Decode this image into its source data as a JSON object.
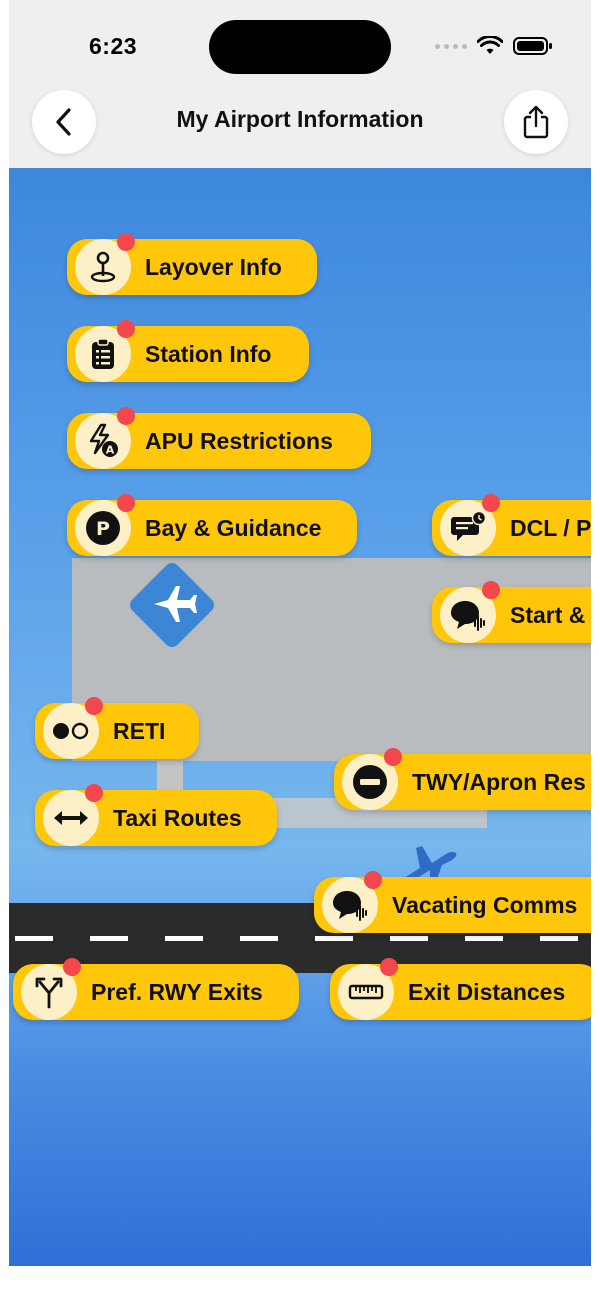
{
  "status_bar": {
    "time": "6:23"
  },
  "nav": {
    "title": "My Airport Information",
    "back_icon": "chevron-left-icon",
    "share_icon": "share-icon"
  },
  "colors": {
    "pill": "#ffc60a",
    "badge": "#f2474c",
    "map_top": "#3d87dc",
    "map_bottom": "#2f6fd6"
  },
  "items": [
    {
      "label": "Layover Info",
      "icon": "map-pin-icon",
      "badge": true
    },
    {
      "label": "Station Info",
      "icon": "clipboard-icon",
      "badge": true
    },
    {
      "label": "APU Restrictions",
      "icon": "lightning-a-icon",
      "badge": true
    },
    {
      "label": "Bay & Guidance",
      "icon": "parking-icon",
      "badge": true
    },
    {
      "label": "DCL / P",
      "icon": "message-clock-icon",
      "badge": true
    },
    {
      "label": "Start &",
      "icon": "speech-bubble-wave-icon",
      "badge": true
    },
    {
      "label": "RETI",
      "icon": "reti-lights-icon",
      "badge": true
    },
    {
      "label": "Taxi Routes",
      "icon": "double-arrow-icon",
      "badge": true
    },
    {
      "label": "TWY/Apron Res",
      "icon": "no-entry-icon",
      "badge": true
    },
    {
      "label": "Vacating Comms",
      "icon": "speech-bubble-wave-icon",
      "badge": true
    },
    {
      "label": "Pref. RWY Exits",
      "icon": "fork-arrows-icon",
      "badge": true
    },
    {
      "label": "Exit Distances",
      "icon": "ruler-icon",
      "badge": true
    }
  ]
}
